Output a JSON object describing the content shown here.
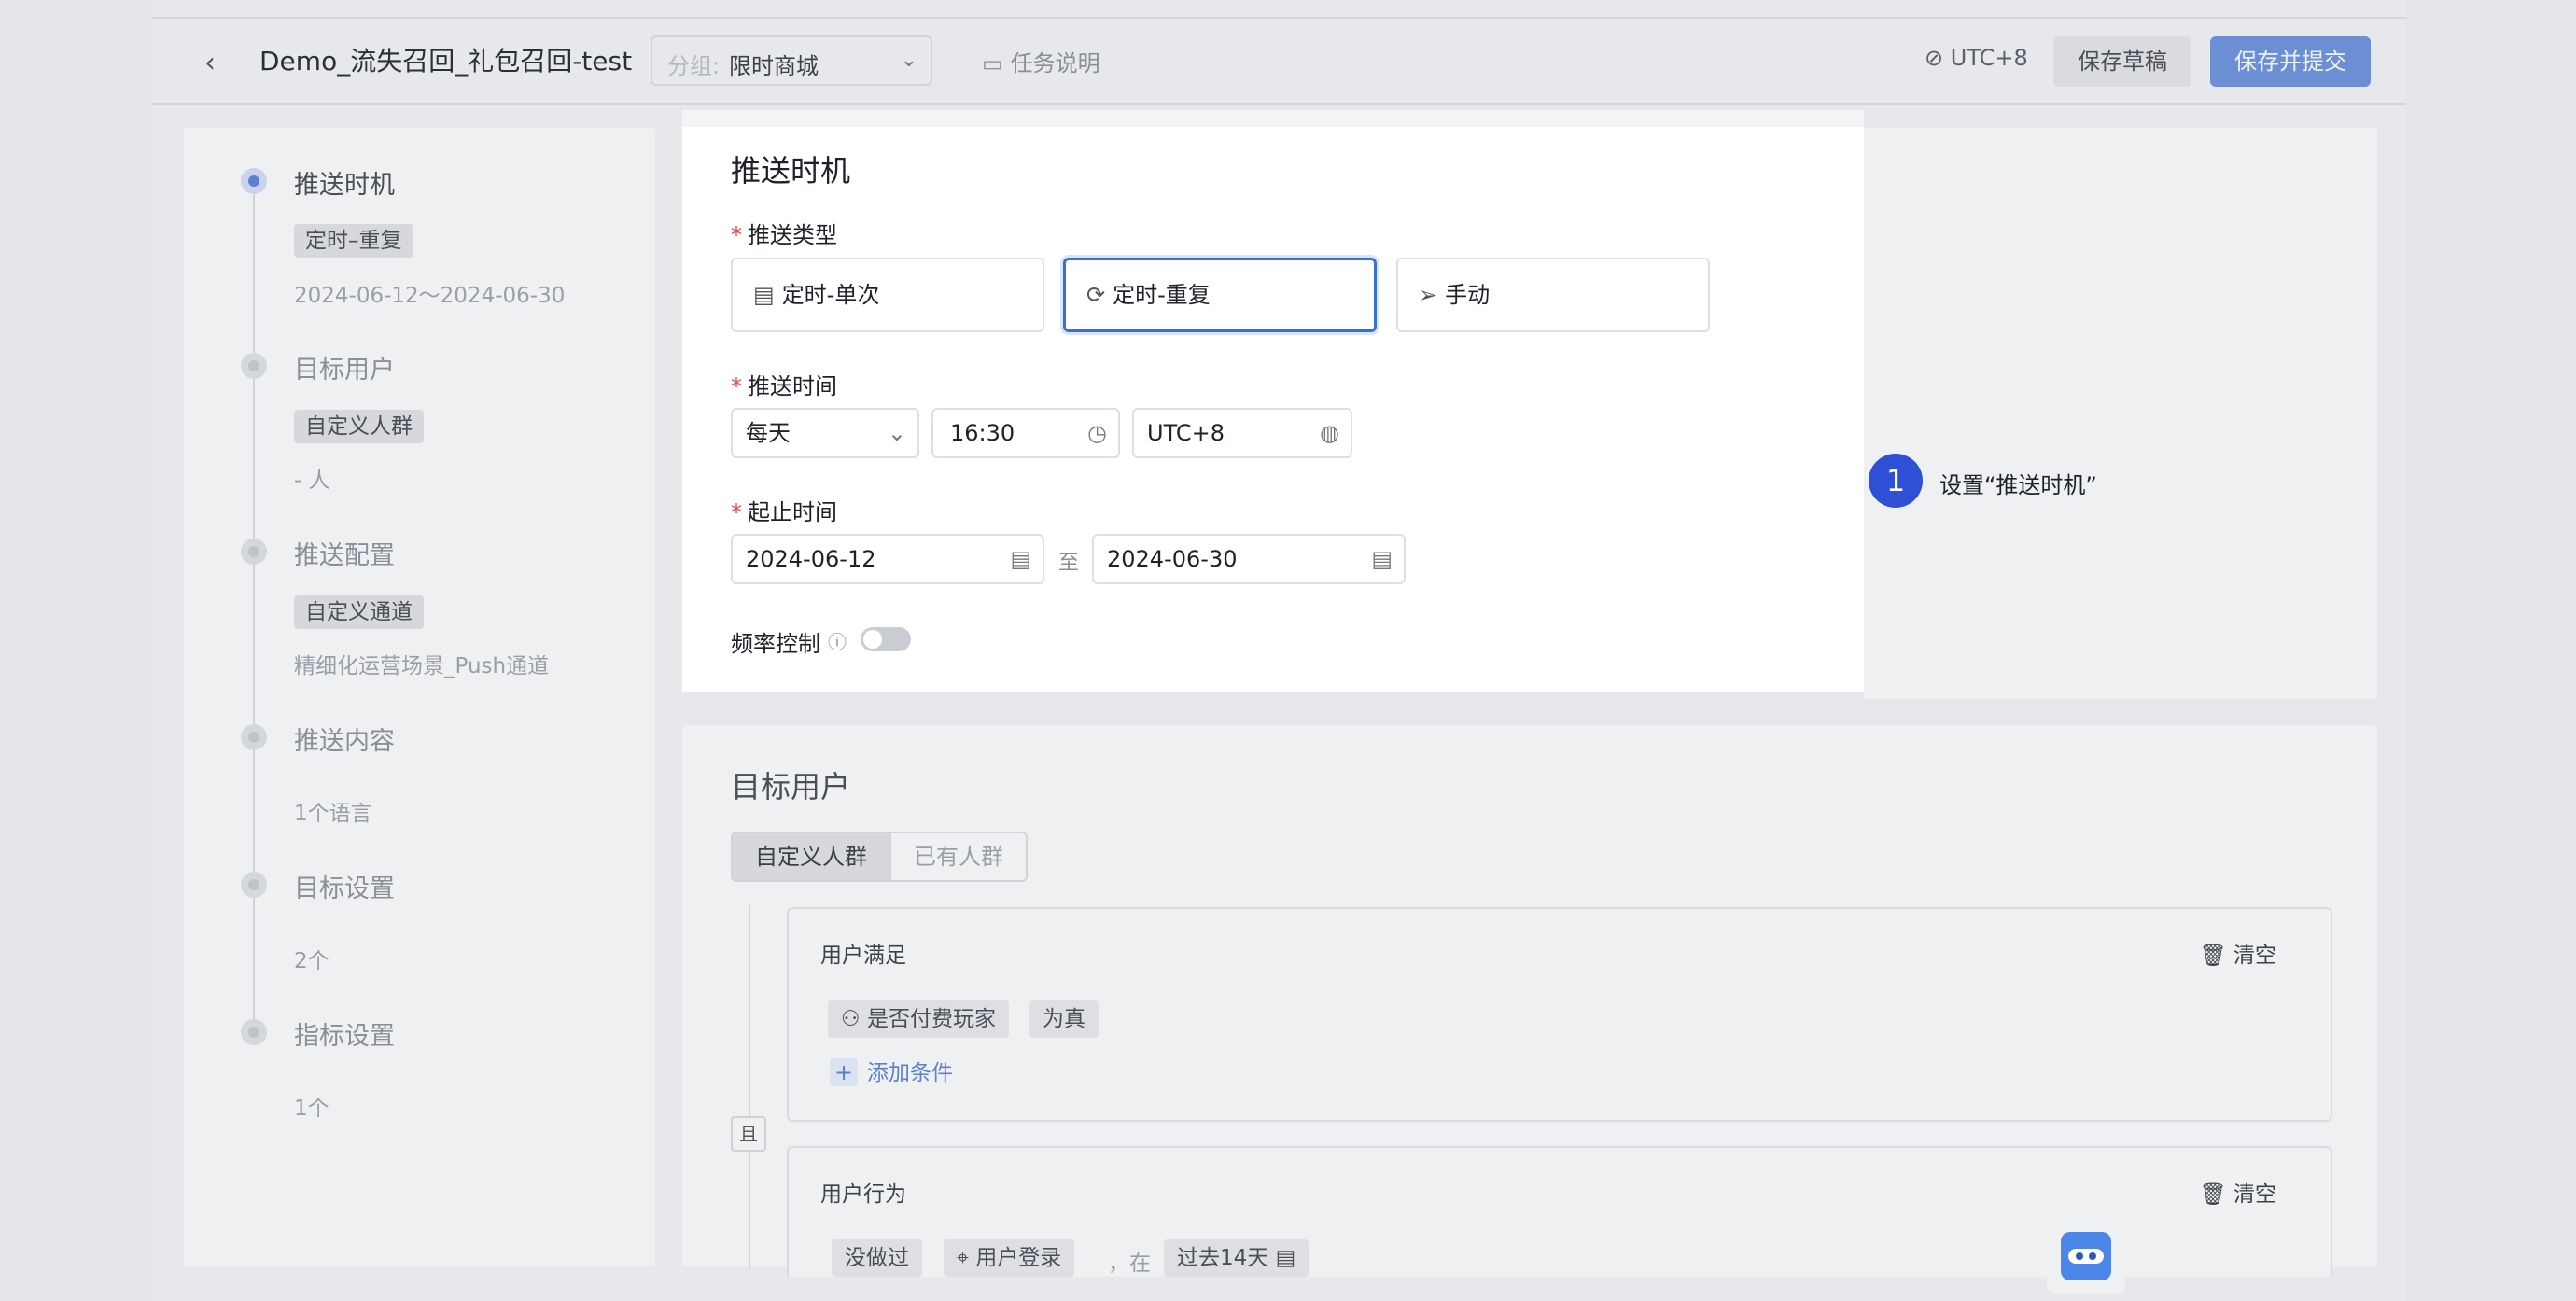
{
  "header": {
    "back_icon": "chevron-left-icon",
    "title": "Demo_流失召回_礼包召回-test",
    "group_label": "分组:",
    "group_value": "限时商城",
    "task_desc": "任务说明",
    "timezone": "UTC+8",
    "save_draft": "保存草稿",
    "save_submit": "保存并提交"
  },
  "sidebar": {
    "steps": [
      {
        "title": "推送时机",
        "tag": "定时–重复",
        "sub": "2024-06-12～2024-06-30",
        "active": true
      },
      {
        "title": "目标用户",
        "tag": "自定义人群",
        "sub": "- 人"
      },
      {
        "title": "推送配置",
        "tag": "自定义通道",
        "sub": "精细化运营场景_Push通道"
      },
      {
        "title": "推送内容",
        "sub": "1个语言"
      },
      {
        "title": "目标设置",
        "sub": "2个"
      },
      {
        "title": "指标设置",
        "sub": "1个"
      }
    ]
  },
  "timing": {
    "section_title": "推送时机",
    "push_type_label": "推送类型",
    "push_types": [
      "定时-单次",
      "定时-重复",
      "手动"
    ],
    "selected_type": "定时-重复",
    "push_time_label": "推送时间",
    "frequency": "每天",
    "time": "16:30",
    "timezone": "UTC+8",
    "range_label": "起止时间",
    "start_date": "2024-06-12",
    "range_sep": "至",
    "end_date": "2024-06-30",
    "freq_control_label": "频率控制",
    "freq_control_on": false
  },
  "callout": {
    "number": "1",
    "text": "设置“推送时机”"
  },
  "target": {
    "section_title": "目标用户",
    "tabs": [
      "自定义人群",
      "已有人群"
    ],
    "and_label": "且",
    "clear_label": "清空",
    "satisfy": {
      "title": "用户满足",
      "chip_attr": "是否付费玩家",
      "chip_value": "为真",
      "add_label": "添加条件"
    },
    "behavior": {
      "title": "用户行为",
      "chip_not_done": "没做过",
      "chip_event": "用户登录",
      "sep": "，在",
      "chip_period": "过去14天"
    }
  }
}
